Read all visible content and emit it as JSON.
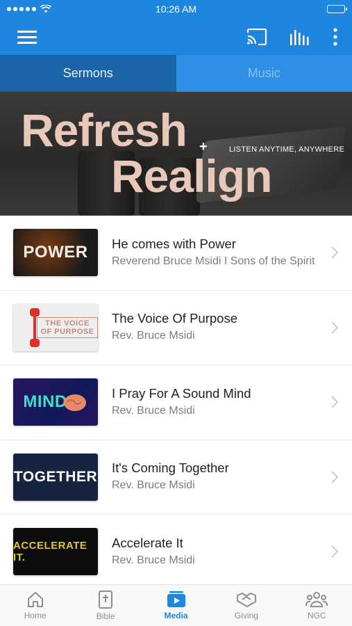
{
  "status_bar": {
    "time": "10:26 AM"
  },
  "tabs": [
    {
      "label": "Sermons"
    },
    {
      "label": "Music"
    }
  ],
  "banner": {
    "line1": "Refresh",
    "line2": "Realign",
    "tagline": "LISTEN ANYTIME, ANYWHERE"
  },
  "sermons": [
    {
      "title": "He comes with Power",
      "subtitle": "Reverend Bruce Msidi I Sons of the Spirit",
      "thumb_text": "POWER"
    },
    {
      "title": "The Voice Of Purpose",
      "subtitle": "Rev. Bruce Msidi",
      "thumb_text": "THE VOICE OF PURPOSE"
    },
    {
      "title": "I Pray For A Sound Mind",
      "subtitle": "Rev. Bruce Msidi",
      "thumb_text": "MIND"
    },
    {
      "title": "It's Coming Together",
      "subtitle": "Rev. Bruce Msidi",
      "thumb_text": "TOGETHER"
    },
    {
      "title": "Accelerate It",
      "subtitle": "Rev. Bruce Msidi",
      "thumb_text": "ACCELERATE IT."
    }
  ],
  "bottom_nav": [
    {
      "label": "Home"
    },
    {
      "label": "Bible"
    },
    {
      "label": "Media"
    },
    {
      "label": "Giving"
    },
    {
      "label": "NGC"
    }
  ],
  "colors": {
    "accent": "#1f86df",
    "tab_active": "#1a65a8"
  }
}
